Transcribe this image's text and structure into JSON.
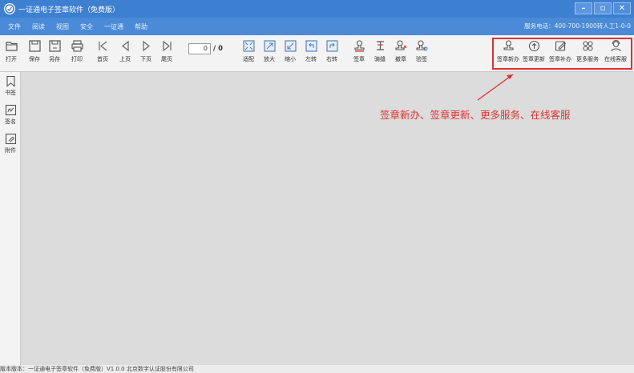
{
  "window": {
    "title": "一证通电子签章软件（免费版）",
    "controls": [
      "–",
      "▫",
      "✕"
    ]
  },
  "menu": {
    "items": [
      "文件",
      "阅读",
      "视图",
      "安全",
      "一证通",
      "帮助"
    ],
    "service_phone": "服务电话：400-700-1900转人工1-0-0"
  },
  "toolbar": {
    "open": "打开",
    "save": "保存",
    "save_as": "另存",
    "print": "打印",
    "first_page": "首页",
    "prev_page": "上页",
    "next_page": "下页",
    "last_page": "尾页",
    "page_current": "0",
    "page_total": "/ 0",
    "fit": "适配",
    "zoom_in": "放大",
    "zoom_out": "缩小",
    "rotate_left": "左转",
    "rotate_right": "右转",
    "sign": "签章",
    "seam_sign": "骑缝",
    "revoke": "撤章",
    "verify": "验签",
    "new_seal": "签章新办",
    "renew_seal": "签章更新",
    "reissue_seal": "签章补办",
    "more_services": "更多服务",
    "online_service": "在线客服"
  },
  "sidebar": {
    "bookmark": "书签",
    "signature": "签名",
    "attachment": "附件"
  },
  "annotation": {
    "text": "签章新办、签章更新、更多服务、在线客服",
    "color": "#e03030"
  },
  "status": {
    "text": "版本版本：一证通电子签章软件（免费版）V1.0.0        北京数字认证股份有限公司"
  },
  "colors": {
    "title_bar": "#3d7fd1",
    "menu_bar": "#4a8ad6",
    "toolbar": "#f3f3f3",
    "canvas": "#dcdcdc"
  }
}
